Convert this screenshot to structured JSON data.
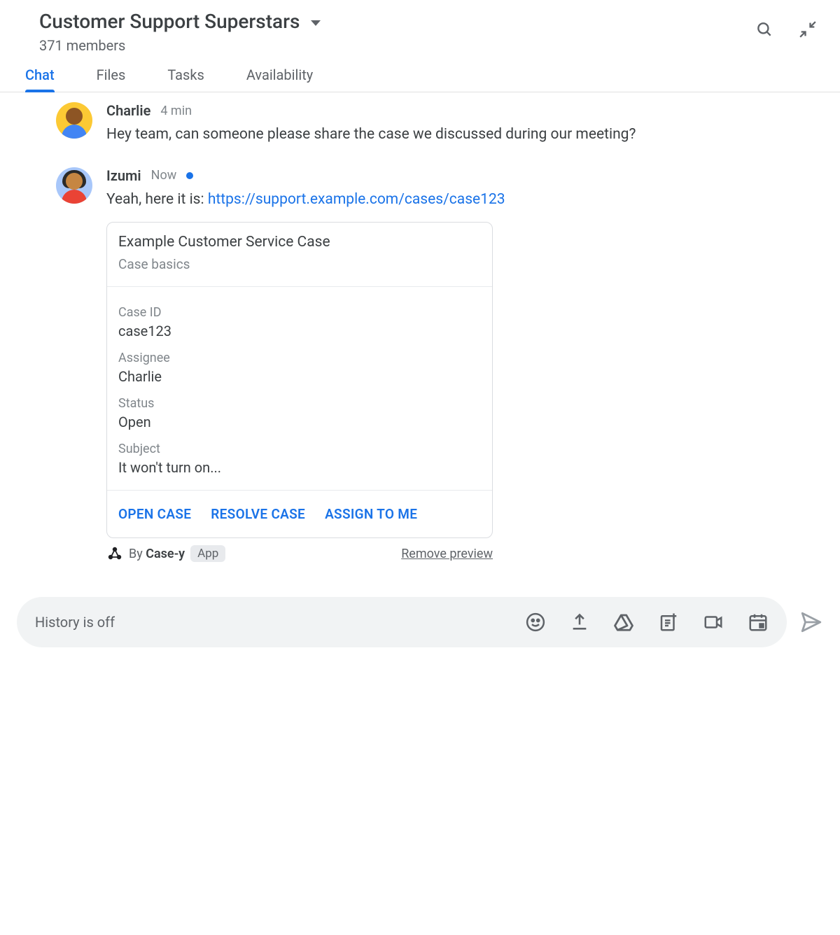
{
  "header": {
    "title": "Customer Support Superstars",
    "members": "371 members"
  },
  "tabs": [
    {
      "label": "Chat",
      "active": true
    },
    {
      "label": "Files",
      "active": false
    },
    {
      "label": "Tasks",
      "active": false
    },
    {
      "label": "Availability",
      "active": false
    }
  ],
  "messages": [
    {
      "author": "Charlie",
      "time": "4 min",
      "presence": false,
      "text": "Hey team, can someone please share the case we discussed during our meeting?"
    },
    {
      "author": "Izumi",
      "time": "Now",
      "presence": true,
      "text_prefix": "Yeah, here it is: ",
      "link": "https://support.example.com/cases/case123"
    }
  ],
  "card": {
    "title": "Example Customer Service Case",
    "subtitle": "Case basics",
    "fields": [
      {
        "label": "Case ID",
        "value": "case123"
      },
      {
        "label": "Assignee",
        "value": "Charlie"
      },
      {
        "label": "Status",
        "value": "Open"
      },
      {
        "label": "Subject",
        "value": "It won't turn on..."
      }
    ],
    "actions": [
      "OPEN CASE",
      "RESOLVE CASE",
      "ASSIGN TO ME"
    ]
  },
  "preview": {
    "by_prefix": "By ",
    "app_name": "Case-y",
    "app_badge": "App",
    "remove": "Remove preview"
  },
  "composer": {
    "placeholder": "History is off"
  }
}
